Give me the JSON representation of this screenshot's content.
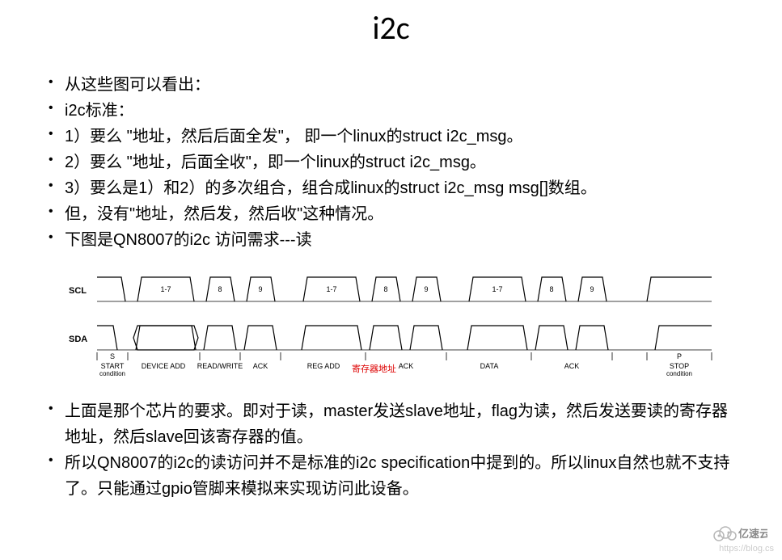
{
  "title": "i2c",
  "bullets_top": [
    "从这些图可以看出：",
    "i2c标准：",
    "1）要么 \"地址，然后后面全发\"， 即一个linux的struct i2c_msg。",
    "2）要么  \"地址，后面全收\"，即一个linux的struct i2c_msg。",
    "3）要么是1）和2）的多次组合，组合成linux的struct i2c_msg msg[]数组。",
    "但，没有\"地址，然后发，然后收\"这种情况。",
    "下图是QN8007的i2c 访问需求---读"
  ],
  "bullets_bottom": [
    "上面是那个芯片的要求。即对于读，master发送slave地址，flag为读，然后发送要读的寄存器地址，然后slave回该寄存器的值。",
    "所以QN8007的i2c的读访问并不是标准的i2c specification中提到的。所以linux自然也就不支持了。只能通过gpio管脚来模拟来实现访问此设备。"
  ],
  "diagram": {
    "scl_label": "SCL",
    "sda_label": "SDA",
    "scl_bits": [
      "1-7",
      "8",
      "9",
      "1-7",
      "8",
      "9",
      "1-7",
      "8",
      "9"
    ],
    "segments": [
      {
        "top": "S",
        "main": "START",
        "sub": "condition"
      },
      {
        "top": "",
        "main": "DEVICE ADD",
        "sub": ""
      },
      {
        "top": "",
        "main": "READ/WRITE",
        "sub": ""
      },
      {
        "top": "",
        "main": "ACK",
        "sub": ""
      },
      {
        "top": "",
        "main": "REG ADD",
        "sub": ""
      },
      {
        "top": "",
        "main": "ACK",
        "sub": ""
      },
      {
        "top": "",
        "main": "DATA",
        "sub": ""
      },
      {
        "top": "",
        "main": "ACK",
        "sub": ""
      },
      {
        "top": "P",
        "main": "STOP",
        "sub": "condition"
      }
    ],
    "red_annotation": "寄存器地址"
  },
  "watermark": "https://blog.cs",
  "logo_text": "亿速云"
}
